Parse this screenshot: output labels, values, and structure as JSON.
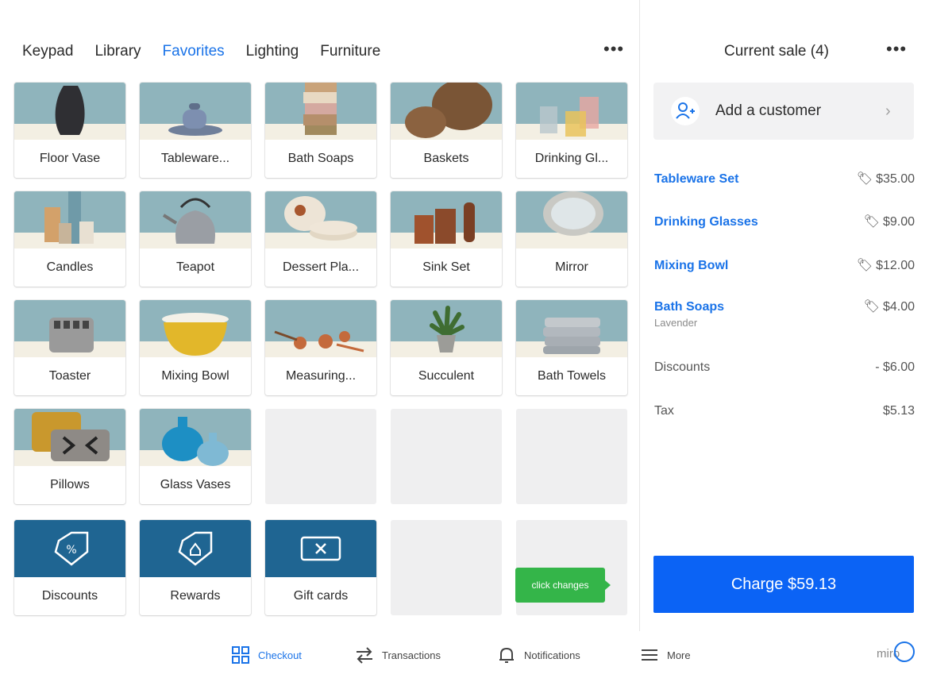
{
  "tabs": [
    {
      "label": "Keypad",
      "active": false
    },
    {
      "label": "Library",
      "active": false
    },
    {
      "label": "Favorites",
      "active": true
    },
    {
      "label": "Lighting",
      "active": false
    },
    {
      "label": "Furniture",
      "active": false
    }
  ],
  "more_label": "•••",
  "items": [
    {
      "label": "Floor Vase",
      "icon": "floor-vase-image"
    },
    {
      "label": "Tableware...",
      "icon": "tableware-image"
    },
    {
      "label": "Bath Soaps",
      "icon": "bath-soaps-image"
    },
    {
      "label": "Baskets",
      "icon": "baskets-image"
    },
    {
      "label": "Drinking Gl...",
      "icon": "drinking-glasses-image"
    },
    {
      "label": "Candles",
      "icon": "candles-image"
    },
    {
      "label": "Teapot",
      "icon": "teapot-image"
    },
    {
      "label": "Dessert Pla...",
      "icon": "dessert-plates-image"
    },
    {
      "label": "Sink Set",
      "icon": "sink-set-image"
    },
    {
      "label": "Mirror",
      "icon": "mirror-image"
    },
    {
      "label": "Toaster",
      "icon": "toaster-image"
    },
    {
      "label": "Mixing Bowl",
      "icon": "mixing-bowl-image"
    },
    {
      "label": "Measuring...",
      "icon": "measuring-cups-image"
    },
    {
      "label": "Succulent",
      "icon": "succulent-image"
    },
    {
      "label": "Bath Towels",
      "icon": "bath-towels-image"
    },
    {
      "label": "Pillows",
      "icon": "pillows-image"
    },
    {
      "label": "Glass Vases",
      "icon": "glass-vases-image"
    }
  ],
  "actions": [
    {
      "label": "Discounts",
      "icon": "discount-tag-icon"
    },
    {
      "label": "Rewards",
      "icon": "rewards-tag-icon"
    },
    {
      "label": "Gift cards",
      "icon": "gift-card-icon"
    }
  ],
  "tooltip": "click changes",
  "sale": {
    "title": "Current sale (4)",
    "add_customer": "Add a customer",
    "lines": [
      {
        "name": "Tableware Set",
        "amount": "$35.00",
        "sub": ""
      },
      {
        "name": "Drinking Glasses",
        "amount": "$9.00",
        "sub": ""
      },
      {
        "name": "Mixing Bowl",
        "amount": "$12.00",
        "sub": ""
      },
      {
        "name": "Bath Soaps",
        "amount": "$4.00",
        "sub": "Lavender"
      }
    ],
    "discounts_label": "Discounts",
    "discounts_value": "- $6.00",
    "tax_label": "Tax",
    "tax_value": "$5.13",
    "charge_label": "Charge $59.13"
  },
  "nav": [
    {
      "label": "Checkout",
      "icon": "grid-icon",
      "active": true
    },
    {
      "label": "Transactions",
      "icon": "swap-arrows-icon",
      "active": false
    },
    {
      "label": "Notifications",
      "icon": "bell-icon",
      "active": false
    },
    {
      "label": "More",
      "icon": "menu-icon",
      "active": false
    }
  ],
  "watermark": "miro",
  "colors": {
    "accent": "#1a73e8",
    "charge": "#0b63f5",
    "action_tile": "#1f6592",
    "tooltip": "#34b549",
    "photo_bg": "#8fb4bc"
  }
}
